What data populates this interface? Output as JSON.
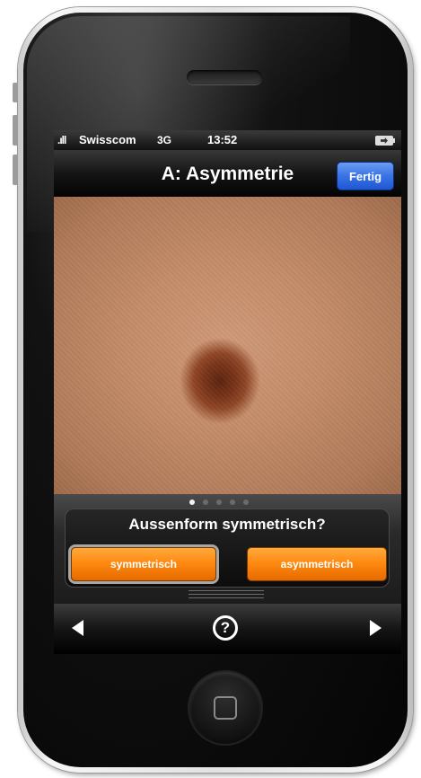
{
  "status_bar": {
    "signal": ".ıll",
    "carrier": "Swisscom",
    "network": "3G",
    "time": "13:52"
  },
  "nav_bar": {
    "title": "A: Asymmetrie",
    "done_label": "Fertig"
  },
  "pager": {
    "page_count": 5,
    "active_index": 0
  },
  "question": {
    "text": "Aussenform symmetrisch?",
    "options": [
      "symmetrisch",
      "asymmetrisch"
    ]
  },
  "toolbar": {
    "help_label": "?",
    "icons": [
      "back-arrow-icon",
      "help-icon",
      "forward-arrow-icon"
    ]
  },
  "colors": {
    "accent_orange": "#ff8a10",
    "done_blue": "#3a72e6"
  }
}
